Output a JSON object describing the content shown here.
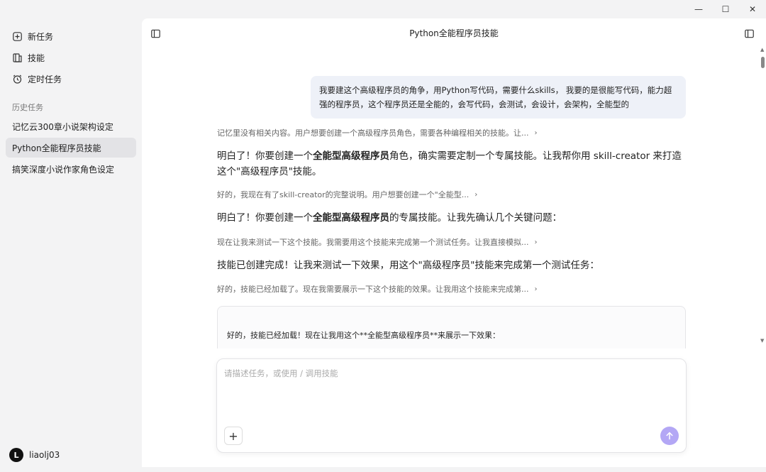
{
  "window": {
    "minimize": "—",
    "maximize": "☐",
    "close": "✕"
  },
  "sidebar": {
    "nav": [
      {
        "label": "新任务",
        "icon": "new-task-icon"
      },
      {
        "label": "技能",
        "icon": "skills-icon"
      },
      {
        "label": "定时任务",
        "icon": "alarm-clock-icon"
      }
    ],
    "history_label": "历史任务",
    "history": [
      {
        "label": "记忆云300章小说架构设定",
        "active": false
      },
      {
        "label": "Python全能程序员技能",
        "active": true
      },
      {
        "label": "搞笑深度小说作家角色设定",
        "active": false
      }
    ],
    "user": {
      "avatar_letter": "L",
      "name": "liaolj03"
    }
  },
  "main": {
    "title": "Python全能程序员技能",
    "user_message": "我要建这个高级程序员的角争，用Python写代码，需要什么skills， 我要的是很能写代码，能力超强的程序员，这个程序员还是全能的，会写代码，会测试，会设计，会架构，全能型的",
    "messages": [
      {
        "thinking": "记忆里没有相关内容。用户想要创建一个高级程序员角色，需要各种编程相关的技能。让...",
        "pre": "明白了！你要创建一个",
        "bold": "全能型高级程序员",
        "post": "角色，确实需要定制一个专属技能。让我帮你用 skill-creator 来打造这个\"高级程序员\"技能。"
      },
      {
        "thinking": "好的，我现在有了skill-creator的完整说明。用户想要创建一个\"全能型...",
        "pre": "明白了！你要创建一个",
        "bold": "全能型高级程序员",
        "post": "的专属技能。让我先确认几个关键问题："
      },
      {
        "thinking": "现在让我来测试一下这个技能。我需要用这个技能来完成第一个测试任务。让我直接模拟...",
        "pre": "技能已创建完成！让我来测试一下效果，用这个\"高级程序员\"技能来完成第一个测试任务：",
        "bold": "",
        "post": ""
      },
      {
        "thinking": "好的，技能已经加载了。现在我需要展示一下这个技能的效果。让我用这个技能来完成第...",
        "pre": "",
        "bold": "",
        "post": ""
      }
    ],
    "card_text": "好的，技能已经加载！现在让我用这个**全能型高级程序员**来展示一下效果：",
    "composer_placeholder": "请描述任务，或使用 / 调用技能"
  }
}
